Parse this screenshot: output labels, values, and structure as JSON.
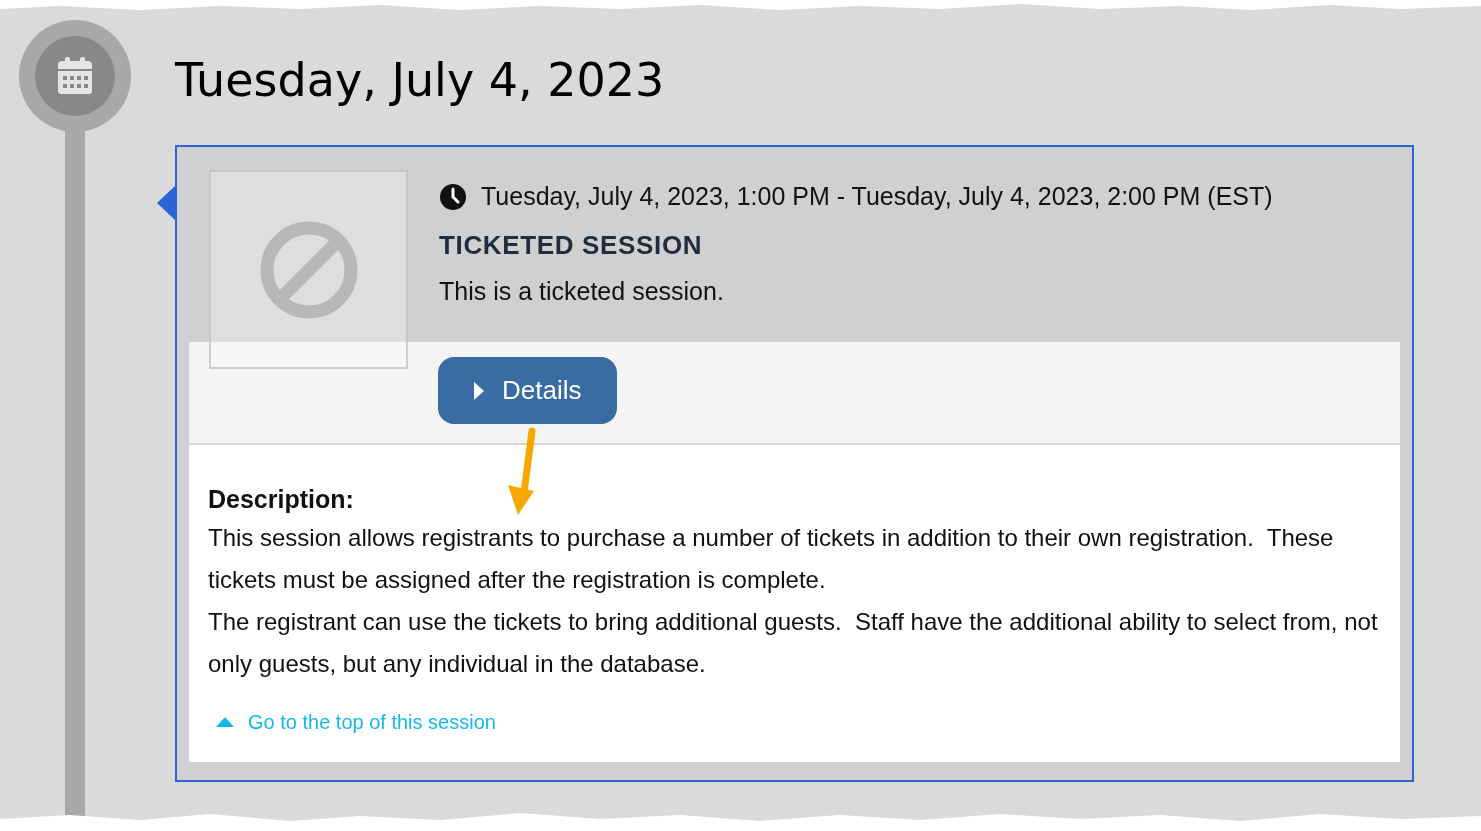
{
  "date_heading": "Tuesday, July 4, 2023",
  "session": {
    "time": "Tuesday, July 4, 2023, 1:00 PM - Tuesday, July 4, 2023, 2:00 PM (EST)",
    "title": "TICKETED SESSION",
    "summary": "This is a ticketed session.",
    "details_button": "Details",
    "description_label": "Description:",
    "description": [
      "This session allows registrants to purchase a number of tickets in addition to their own registration.  These tickets must be assigned after the registration is complete.",
      "The registrant can use the tickets to bring additional guests.  Staff have the additional ability to select from, not only guests, but any individual in the database."
    ],
    "top_link": "Go to the top of this session"
  }
}
